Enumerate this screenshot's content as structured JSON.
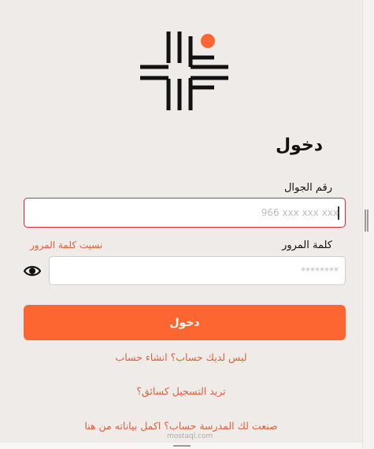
{
  "login": {
    "title": "دخول",
    "phone_label": "رقم الجوال",
    "phone_placeholder": "966 xxx xxx xxx",
    "password_label": "كلمة المرور",
    "password_placeholder": "********",
    "forgot_password": "نسيت كلمة المرور",
    "submit_label": "دخول"
  },
  "links": {
    "no_account": "ليس لديك حساب؟ انشاء حساب",
    "register_driver": "تريد التسجيل كسائق؟",
    "school_account": "صنعت لك المدرسة حساب؟ اكمل بياناته من هنا"
  },
  "watermark": "mostaql.com",
  "colors": {
    "accent": "#fd6630",
    "link": "#e0603a",
    "error_border": "#d62e2e",
    "background": "#efebe9"
  },
  "icons": {
    "logo": "brand-logo",
    "password_toggle": "eye-icon"
  }
}
